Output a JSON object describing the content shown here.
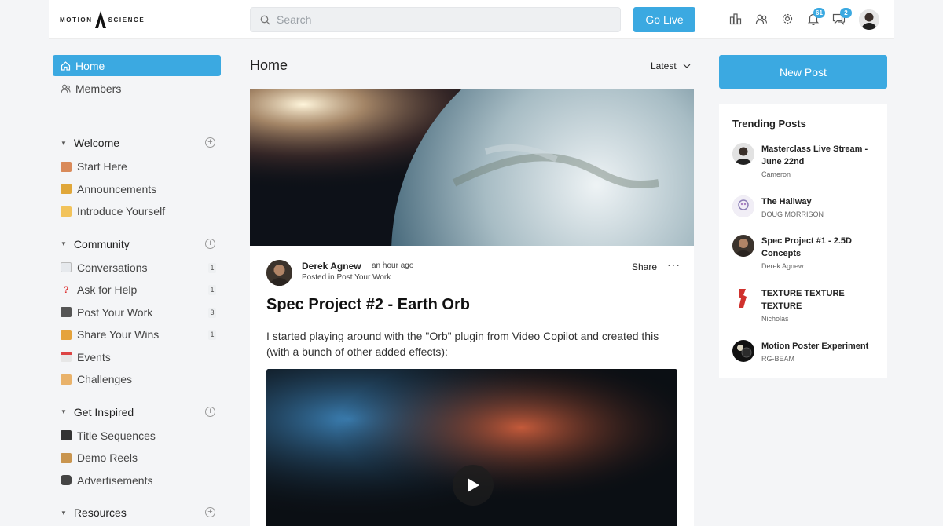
{
  "header": {
    "logo_text_left": "MOTION",
    "logo_text_right": "SCIENCE",
    "search_placeholder": "Search",
    "go_live_label": "Go Live",
    "notifications_count": "61",
    "messages_count": "2",
    "accent_color": "#3ba9e1"
  },
  "sidebar": {
    "nav": [
      {
        "label": "Home",
        "icon": "home-icon",
        "active": true
      },
      {
        "label": "Members",
        "icon": "members-icon",
        "active": false
      }
    ],
    "spaces": [
      {
        "title": "Welcome",
        "items": [
          {
            "label": "Start Here",
            "icon": "house-emoji",
            "count": ""
          },
          {
            "label": "Announcements",
            "icon": "megaphone-emoji",
            "count": ""
          },
          {
            "label": "Introduce Yourself",
            "icon": "wave-emoji",
            "count": ""
          }
        ]
      },
      {
        "title": "Community",
        "items": [
          {
            "label": "Conversations",
            "icon": "speech-bubble-emoji",
            "count": "1"
          },
          {
            "label": "Ask for Help",
            "icon": "question-emoji",
            "count": "1"
          },
          {
            "label": "Post Your Work",
            "icon": "monitor-emoji",
            "count": "3"
          },
          {
            "label": "Share Your Wins",
            "icon": "party-emoji",
            "count": "1"
          },
          {
            "label": "Events",
            "icon": "calendar-emoji",
            "count": ""
          },
          {
            "label": "Challenges",
            "icon": "muscle-emoji",
            "count": ""
          }
        ]
      },
      {
        "title": "Get Inspired",
        "items": [
          {
            "label": "Title Sequences",
            "icon": "clapper-emoji",
            "count": ""
          },
          {
            "label": "Demo Reels",
            "icon": "film-emoji",
            "count": ""
          },
          {
            "label": "Advertisements",
            "icon": "camera-emoji",
            "count": ""
          }
        ]
      },
      {
        "title": "Resources",
        "items": []
      }
    ]
  },
  "main": {
    "title": "Home",
    "sort_label": "Latest",
    "post": {
      "author": "Derek Agnew",
      "time": "an hour ago",
      "posted_in": "Posted in Post Your Work",
      "share_label": "Share",
      "more_label": "···",
      "title": "Spec Project #2 - Earth Orb",
      "body": "I started playing around with the \"Orb\" plugin from Video Copilot and created this (with a bunch of other added effects):"
    }
  },
  "right": {
    "new_post_label": "New Post",
    "trending_title": "Trending Posts",
    "trending": [
      {
        "title": "Masterclass Live Stream - June 22nd",
        "author": "Cameron"
      },
      {
        "title": "The Hallway",
        "author": "DOUG MORRISON"
      },
      {
        "title": "Spec Project #1 - 2.5D Concepts",
        "author": "Derek Agnew"
      },
      {
        "title": "TEXTURE TEXTURE TEXTURE",
        "author": "Nicholas"
      },
      {
        "title": "Motion Poster Experiment",
        "author": "RG-BEAM"
      }
    ]
  }
}
